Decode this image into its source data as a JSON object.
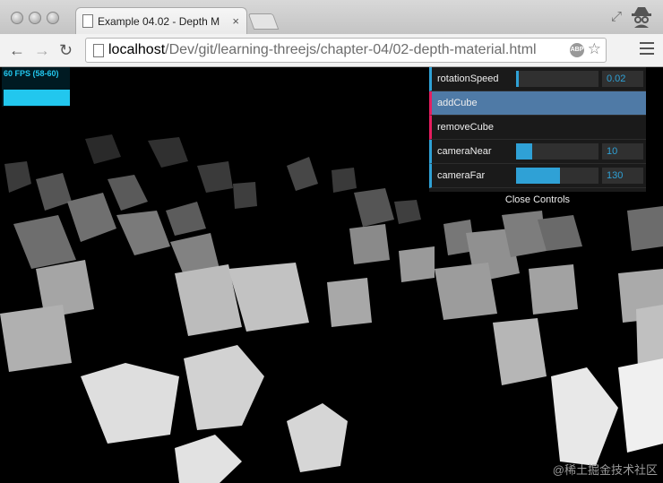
{
  "browser": {
    "tab": {
      "title": "Example 04.02 - Depth M",
      "close": "×"
    },
    "nav": {
      "back": "←",
      "forward": "→",
      "reload": "↻"
    },
    "url": {
      "host": "localhost",
      "path": "/Dev/git/learning-threejs/chapter-04/02-depth-material.html"
    },
    "extension_badge": "ABP",
    "star": "☆",
    "fullscreen": "⤢"
  },
  "stats": {
    "text": "60 FPS (58-60)",
    "color": "#22c7ee"
  },
  "controls": {
    "rows": [
      {
        "name": "rotationSpeed",
        "type": "slider",
        "value": "0.02",
        "fraction": 0.03
      },
      {
        "name": "addCube",
        "type": "function",
        "highlighted": true
      },
      {
        "name": "removeCube",
        "type": "function",
        "highlighted": false
      },
      {
        "name": "cameraNear",
        "type": "slider",
        "value": "10",
        "fraction": 0.2
      },
      {
        "name": "cameraFar",
        "type": "slider",
        "value": "130",
        "fraction": 0.53
      }
    ],
    "close_label": "Close Controls"
  },
  "watermark": "@稀土掘金技术社区",
  "colors": {
    "gui_accent": "#2fa1d6",
    "gui_function": "#e61d5f",
    "gui_highlight": "#4f7aa6",
    "scene_bg": "#000000"
  }
}
